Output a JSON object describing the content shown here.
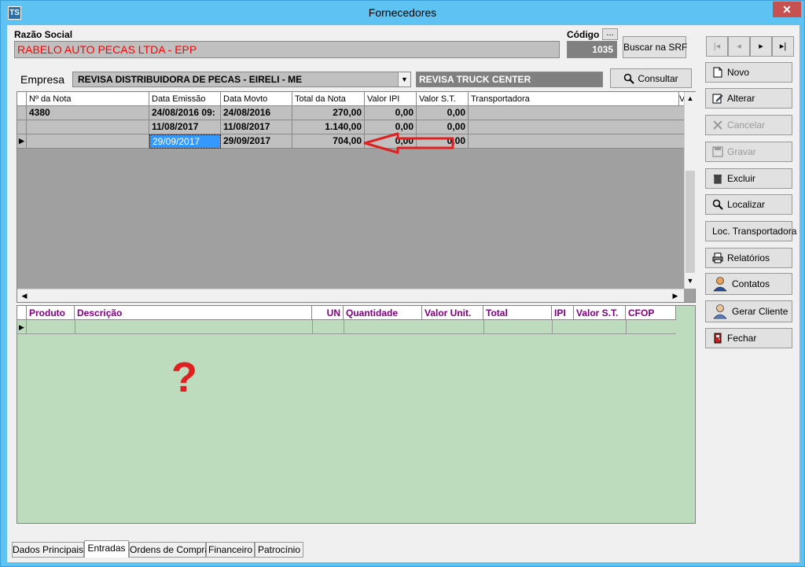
{
  "window": {
    "title": "Fornecedores",
    "icon_text": "TS",
    "close": "✕"
  },
  "razao": {
    "label": "Razão Social",
    "value": "RABELO AUTO PECAS LTDA - EPP",
    "color": "#ff0000"
  },
  "codigo": {
    "label": "Código",
    "ellipsis": "...",
    "value": "1035"
  },
  "buscar_srf": "Buscar na SRF",
  "nav": {
    "first": "|◂",
    "prev": "◂",
    "next": "▸",
    "last": "▸|"
  },
  "empresa": {
    "label": "Empresa",
    "value": "REVISA DISTRIBUIDORA DE PECAS - EIRELI - ME",
    "alias": "REVISA TRUCK CENTER"
  },
  "consultar": "Consultar",
  "grid1": {
    "columns": [
      "Nº da Nota",
      "Data Emissão",
      "Data Movto",
      "Total da Nota",
      "Valor IPI",
      "Valor S.T.",
      "Transportadora",
      "V"
    ],
    "rows": [
      [
        "4380",
        "24/08/2016 09:",
        "24/08/2016",
        "270,00",
        "0,00",
        "0,00",
        ""
      ],
      [
        "",
        "11/08/2017",
        "11/08/2017",
        "1.140,00",
        "0,00",
        "0,00",
        ""
      ],
      [
        "",
        "29/09/2017",
        "29/09/2017",
        "704,00",
        "0,00",
        "0,00",
        ""
      ]
    ]
  },
  "grid2": {
    "columns": [
      "Produto",
      "Descrição",
      "UN",
      "Quantidade",
      "Valor Unit.",
      "Total",
      "IPI",
      "Valor S.T.",
      "CFOP"
    ]
  },
  "annotation": {
    "question": "?",
    "color": "#e02020"
  },
  "side_buttons": [
    {
      "label": "Novo",
      "icon": "new-document-icon",
      "enabled": true
    },
    {
      "label": "Alterar",
      "icon": "edit-icon",
      "enabled": true
    },
    {
      "label": "Cancelar",
      "icon": "cancel-icon",
      "enabled": false
    },
    {
      "label": "Gravar",
      "icon": "save-icon",
      "enabled": false
    },
    {
      "label": "Excluir",
      "icon": "trash-icon",
      "enabled": true
    },
    {
      "label": "Localizar",
      "icon": "search-icon",
      "enabled": true
    },
    {
      "label": "Loc. Transportadora",
      "icon": "",
      "enabled": true
    },
    {
      "label": "Relatórios",
      "icon": "printer-icon",
      "enabled": true
    },
    {
      "label": "Contatos",
      "icon": "person-icon",
      "enabled": true
    },
    {
      "label": "Gerar Cliente",
      "icon": "user-icon",
      "enabled": true
    },
    {
      "label": "Fechar",
      "icon": "exit-door-icon",
      "enabled": true
    }
  ],
  "tabs": [
    "Dados Principais",
    "Entradas",
    "Ordens de Compra",
    "Financeiro",
    "Patrocínio"
  ],
  "active_tab": "Entradas"
}
